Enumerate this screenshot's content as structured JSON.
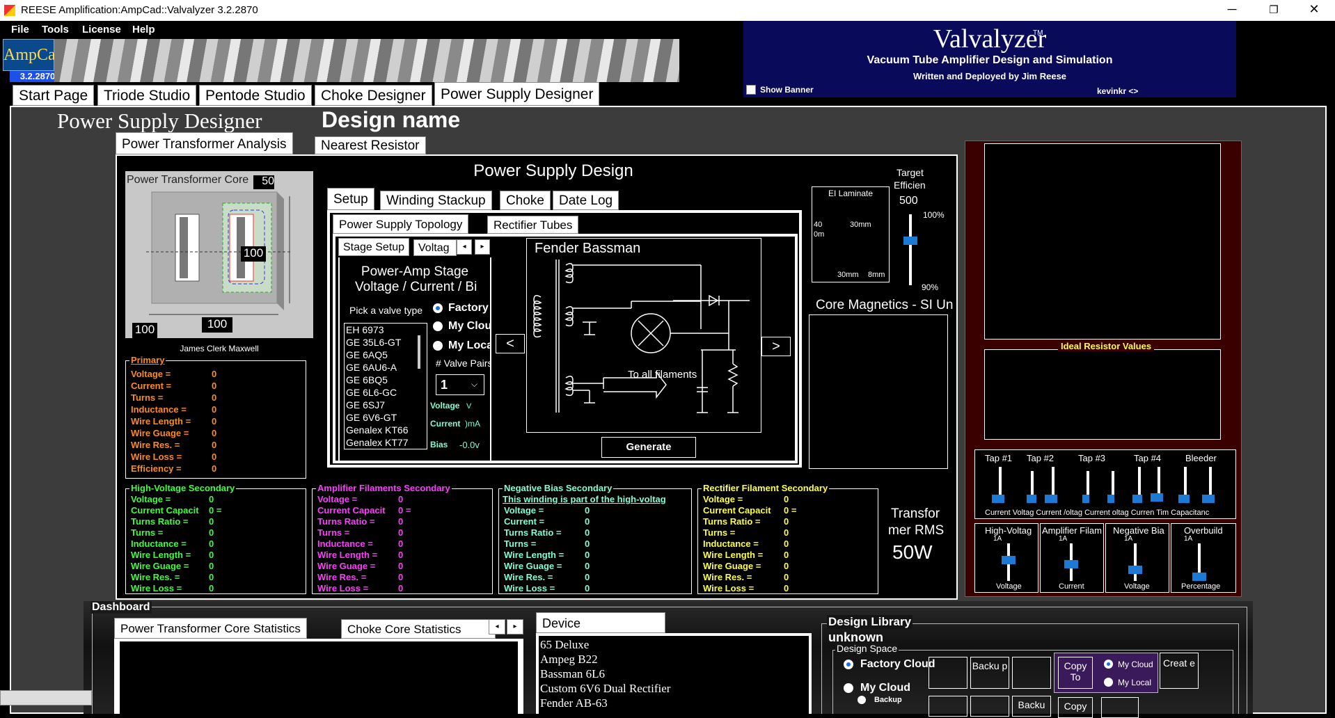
{
  "window": {
    "title": "REESE Amplification:AmpCad::Valvalyzer 3.2.2870"
  },
  "menu": [
    "File",
    "Tools",
    "License",
    "Help"
  ],
  "logo": {
    "text": "AmpCad",
    "version": "3.2.2870"
  },
  "banner": {
    "title": "Valvalyzer",
    "tm": "TM",
    "subtitle": "Vacuum Tube Amplifier Design and Simulation",
    "author": "Written and Deployed by Jim Reese",
    "show_banner": "Show Banner",
    "user": "kevinkr  <>"
  },
  "main_tabs": [
    "Start Page",
    "Triode Studio",
    "Pentode Studio",
    "Choke Designer",
    "Power Supply Designer"
  ],
  "page": {
    "heading": "Power Supply Designer",
    "design_name": "Design name"
  },
  "sub_tabs": [
    "Power Transformer Analysis",
    "Nearest Resistor"
  ],
  "core": {
    "title": "Power Transformer Core",
    "dim_top": "50",
    "dim_right": "100",
    "dim_bottom": "100",
    "dim_left": "100",
    "caption": "James Clerk Maxwell"
  },
  "primary": {
    "title": "Primary",
    "rows": [
      [
        "Voltage =",
        "0"
      ],
      [
        "Current =",
        "0"
      ],
      [
        "Turns =",
        "0"
      ],
      [
        "Inductance =",
        "0"
      ],
      [
        "Wire Length =",
        "0"
      ],
      [
        "Wire Guage =",
        "0"
      ],
      [
        "Wire Res. =",
        "0"
      ],
      [
        "Wire Loss =",
        "0"
      ],
      [
        "Efficiency =",
        "0"
      ]
    ]
  },
  "design": {
    "title": "Power Supply Design",
    "tabs": [
      "Setup",
      "Winding Stackup",
      "Choke",
      "Date Log"
    ],
    "inner_tabs": [
      "Power Supply Topology",
      "Rectifier Tubes"
    ],
    "stage_tabs": [
      "Stage Setup",
      "Voltag"
    ],
    "stage_title1": "Power-Amp Stage",
    "stage_title2": "Voltage / Current / Bi",
    "pick": "Pick a valve type",
    "radios": [
      "Factory",
      "My Clou",
      "My Loca"
    ],
    "valves": [
      "EH 6973",
      "GE 35L6-GT",
      "GE 6AQ5",
      "GE 6AU6-A",
      "GE 6BQ5",
      "GE 6L6-GC",
      "GE 6SJ7",
      "GE 6V6-GT",
      "Genalex KT66",
      "Genalex KT77"
    ],
    "valve_pairs": "# Valve Pairs",
    "pairs_value": "1",
    "voltage": "Voltage",
    "voltage_unit": "V",
    "current": "Current",
    "current_unit": ")mA",
    "bias": "Bias",
    "bias_value": "-0.0v",
    "topology_name": "Fender Bassman",
    "filaments": "To all filaments",
    "prev": "<",
    "next": ">",
    "generate": "Generate"
  },
  "lamination": {
    "title": "EI Laminate",
    "l1": "40",
    "l2": "0m",
    "l3": "30mm",
    "l4": "30mm",
    "l5": "8mm"
  },
  "efficiency": {
    "title1": "Target",
    "title2": "Efficien",
    "value": "500",
    "top": "100%",
    "bottom": "90%",
    "level": 0.6
  },
  "magnetics": {
    "title": "Core Magnetics - SI Un"
  },
  "hv": {
    "title": "High-Voltage Secondary",
    "rows": [
      [
        "Voltage =",
        "0"
      ],
      [
        "Current Capacit",
        "0 ="
      ],
      [
        "Turns Ratio =",
        "0"
      ],
      [
        "Turns =",
        "0"
      ],
      [
        "Inductance =",
        "0"
      ],
      [
        "Wire Length =",
        "0"
      ],
      [
        "Wire Guage =",
        "0"
      ],
      [
        "Wire Res. =",
        "0"
      ],
      [
        "Wire Loss =",
        "0"
      ]
    ]
  },
  "amp": {
    "title": "Amplifier Filaments Secondary",
    "rows": [
      [
        "Voltage =",
        "0"
      ],
      [
        "Current Capacit",
        "0 ="
      ],
      [
        "Turns Ratio =",
        "0"
      ],
      [
        "Turns =",
        "0"
      ],
      [
        "Inductance =",
        "0"
      ],
      [
        "Wire Length =",
        "0"
      ],
      [
        "Wire Guage =",
        "0"
      ],
      [
        "Wire Res. =",
        "0"
      ],
      [
        "Wire Loss =",
        "0"
      ]
    ]
  },
  "neg": {
    "title": "Negative Bias Secondary",
    "note": "This winding is part of the high-voltag",
    "rows": [
      [
        "Voltage =",
        "0"
      ],
      [
        "Current =",
        "0"
      ],
      [
        "Turns Ratio =",
        "0"
      ],
      [
        "Turns =",
        "0"
      ],
      [
        "Wire Length =",
        "0"
      ],
      [
        "Wire Guage =",
        "0"
      ],
      [
        "Wire Res. =",
        "0"
      ],
      [
        "Wire Loss =",
        "0"
      ]
    ]
  },
  "rect": {
    "title": "Rectifier Filament Secondary",
    "rows": [
      [
        "Voltage =",
        "0"
      ],
      [
        "Current Capacit",
        "0 ="
      ],
      [
        "Turns Ratio =",
        "0"
      ],
      [
        "Turns =",
        "0"
      ],
      [
        "Inductance =",
        "0"
      ],
      [
        "Wire Length =",
        "0"
      ],
      [
        "Wire Guage =",
        "0"
      ],
      [
        "Wire Res. =",
        "0"
      ],
      [
        "Wire Loss =",
        "0"
      ]
    ]
  },
  "rms": {
    "l1": "Transfor",
    "l2": "mer RMS",
    "value": "50W"
  },
  "right": {
    "ideal": "Ideal Resistor Values",
    "taps": [
      "Tap #1",
      "Tap #2",
      "Tap #3",
      "Tap #4",
      "Bleeder"
    ],
    "tap_labels": "Current Voltag Current /oltag Current oltag Curren Tim Capacitanc",
    "bottom_sliders": [
      {
        "t": "High-Voltag",
        "s": "1A",
        "b": "Voltage"
      },
      {
        "t": "Amplifier Filam",
        "s": "1A",
        "b": "Current"
      },
      {
        "t": "Negative Bia",
        "s": "1A",
        "b": "Voltage"
      },
      {
        "t": "Overbuild",
        "s": "1A",
        "b": "Percentage"
      }
    ]
  },
  "dashboard": {
    "title": "Dashboard",
    "tabs": [
      "Power Transformer Core Statistics",
      "Choke Core Statistics"
    ],
    "device_tab": "Device",
    "devices": [
      "65 Deluxe",
      "Ampeg B22",
      "Bassman 6L6",
      "Custom 6V6 Dual Rectifier",
      "Fender AB-63"
    ],
    "library_title": "Design Library",
    "library_name": "unknown",
    "space": "Design Space",
    "factory": "Factory Cloud",
    "mycloud": "My Cloud",
    "backup_small": "Backup",
    "backup": "Backu p",
    "copy": "Copy To",
    "r_mycloud": "My Cloud",
    "r_mylocal": "My Local",
    "create": "Creat e",
    "backu2": "Backu",
    "copy2": "Copy"
  }
}
